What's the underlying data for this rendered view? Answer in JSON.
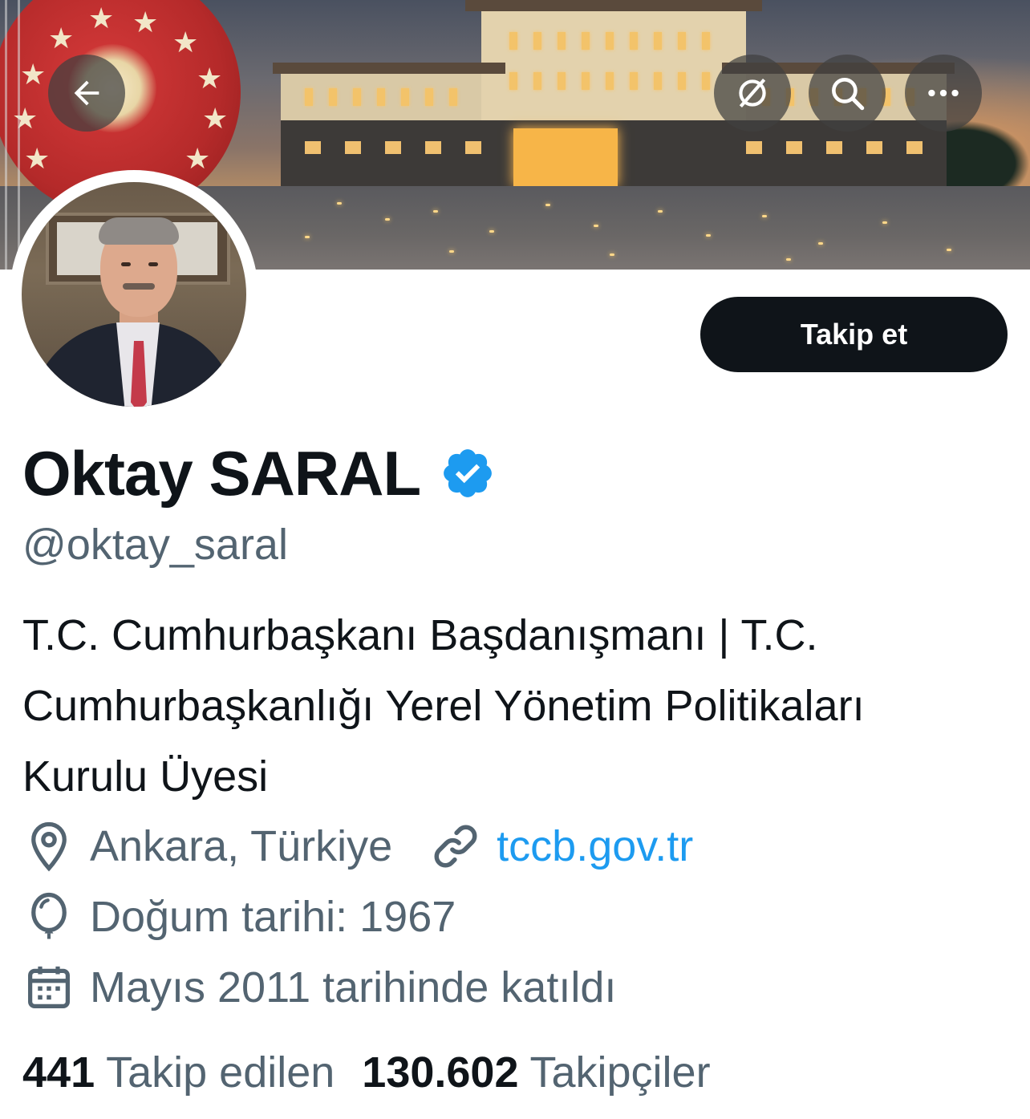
{
  "header": {
    "back_icon": "arrow-left-icon",
    "actions": [
      {
        "icon": "hide-reposts-icon"
      },
      {
        "icon": "search-icon"
      },
      {
        "icon": "more-icon"
      }
    ]
  },
  "profile": {
    "display_name": "Oktay SARAL",
    "verified": true,
    "verified_color": "#1d9bf0",
    "handle": "@oktay_saral",
    "follow_button": "Takip et",
    "bio_lines": [
      "T.C. Cumhurbaşkanı Başdanışmanı | T.C.",
      "Cumhurbaşkanlığı Yerel Yönetim Politikaları",
      "Kurulu Üyesi"
    ],
    "location": "Ankara, Türkiye",
    "website": "tccb.gov.tr",
    "birth": "Doğum tarihi: 1967",
    "joined": "Mayıs 2011 tarihinde katıldı"
  },
  "stats": {
    "following_count": "441",
    "following_label": "Takip edilen",
    "followers_count": "130.602",
    "followers_label": "Takipçiler"
  },
  "colors": {
    "text_primary": "#0f1419",
    "text_secondary": "#536471",
    "link": "#1d9bf0",
    "button_bg": "#0f1419"
  }
}
